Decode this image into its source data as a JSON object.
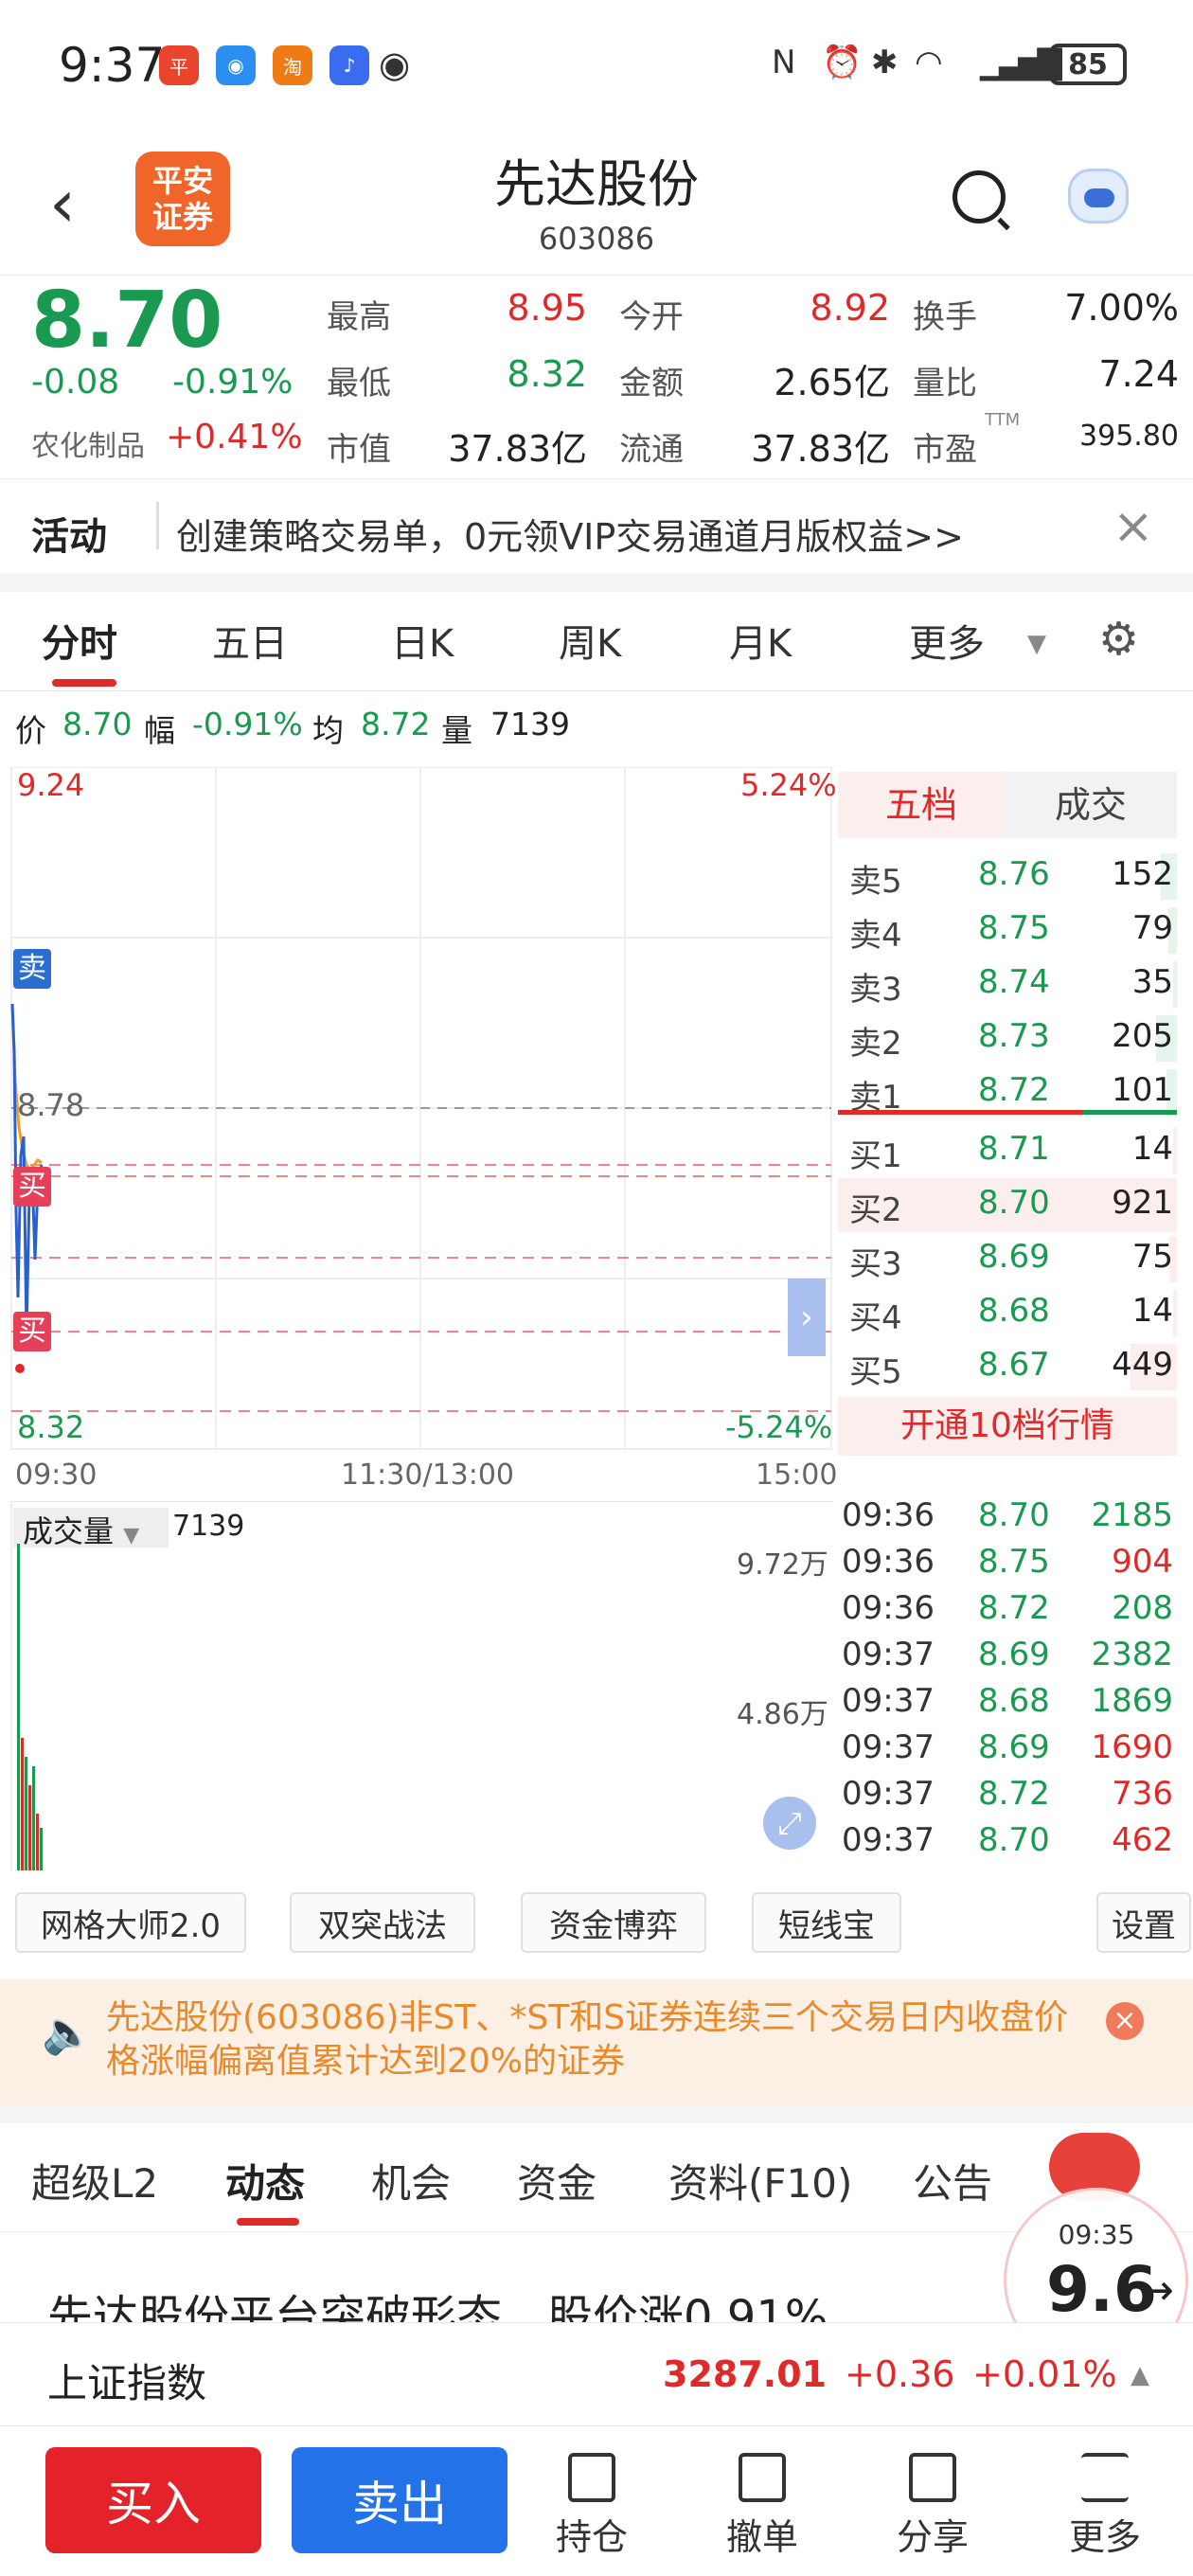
{
  "status": {
    "time": "9:37",
    "battery": "85"
  },
  "header": {
    "name": "先达股份",
    "code": "603086",
    "broker_logo": "平安\n证券"
  },
  "quote": {
    "price": "8.70",
    "change": "-0.08",
    "change_pct": "-0.91%",
    "sector": "农化制品",
    "sector_pct": "+0.41%",
    "fields": [
      {
        "label": "最高",
        "value": "8.95",
        "color": "red"
      },
      {
        "label": "今开",
        "value": "8.92",
        "color": "red"
      },
      {
        "label": "换手",
        "value": "7.00%",
        "color": "dark"
      },
      {
        "label": "最低",
        "value": "8.32",
        "color": "green"
      },
      {
        "label": "金额",
        "value": "2.65亿",
        "color": "dark"
      },
      {
        "label": "量比",
        "value": "7.24",
        "color": "dark"
      },
      {
        "label": "市值",
        "value": "37.83亿",
        "color": "dark"
      },
      {
        "label": "流通",
        "value": "37.83亿",
        "color": "dark"
      },
      {
        "label": "市盈",
        "sup": "TTM",
        "value": "395.80",
        "color": "dark"
      }
    ]
  },
  "activity": {
    "label": "活动",
    "text": "创建策略交易单，0元领VIP交易通道月版权益>>"
  },
  "tabs": [
    "分时",
    "五日",
    "日K",
    "周K",
    "月K",
    "更多"
  ],
  "info": {
    "price_label": "价",
    "price": "8.70",
    "amp_label": "幅",
    "amp": "-0.91%",
    "avg_label": "均",
    "avg": "8.72",
    "vol_label": "量",
    "vol": "7139"
  },
  "chart": {
    "top_left": "9.24",
    "top_right": "5.24%",
    "bottom_left": "8.32",
    "bottom_right": "-5.24%",
    "mid_label": "8.78",
    "times": [
      "09:30",
      "11:30/13:00",
      "15:00"
    ],
    "sell_tag": "卖",
    "buy_tag": "买"
  },
  "volume": {
    "label": "成交量",
    "value": "7139",
    "top": "9.72万",
    "mid": "4.86万"
  },
  "orderbook": {
    "tab_active": "五档",
    "tab_other": "成交",
    "asks": [
      {
        "l": "卖5",
        "p": "8.76",
        "v": "152",
        "f": 0.17
      },
      {
        "l": "卖4",
        "p": "8.75",
        "v": "79",
        "f": 0.09
      },
      {
        "l": "卖3",
        "p": "8.74",
        "v": "35",
        "f": 0.04
      },
      {
        "l": "卖2",
        "p": "8.73",
        "v": "205",
        "f": 0.22
      },
      {
        "l": "卖1",
        "p": "8.72",
        "v": "101",
        "f": 0.11
      }
    ],
    "bids": [
      {
        "l": "买1",
        "p": "8.71",
        "v": "14",
        "f": 0.02
      },
      {
        "l": "买2",
        "p": "8.70",
        "v": "921",
        "f": 1.0
      },
      {
        "l": "买3",
        "p": "8.69",
        "v": "75",
        "f": 0.08
      },
      {
        "l": "买4",
        "p": "8.68",
        "v": "14",
        "f": 0.02
      },
      {
        "l": "买5",
        "p": "8.67",
        "v": "449",
        "f": 0.49
      }
    ],
    "more": "开通10档行情"
  },
  "trades": [
    {
      "t": "09:36",
      "p": "8.70",
      "v": "2185",
      "c": "green"
    },
    {
      "t": "09:36",
      "p": "8.75",
      "v": "904",
      "c": "red"
    },
    {
      "t": "09:36",
      "p": "8.72",
      "v": "208",
      "c": "green"
    },
    {
      "t": "09:37",
      "p": "8.69",
      "v": "2382",
      "c": "green"
    },
    {
      "t": "09:37",
      "p": "8.68",
      "v": "1869",
      "c": "green"
    },
    {
      "t": "09:37",
      "p": "8.69",
      "v": "1690",
      "c": "red"
    },
    {
      "t": "09:37",
      "p": "8.72",
      "v": "736",
      "c": "red"
    },
    {
      "t": "09:37",
      "p": "8.70",
      "v": "462",
      "c": "red"
    }
  ],
  "tools": [
    "网格大师2.0",
    "双突战法",
    "资金博弈",
    "短线宝",
    "设置"
  ],
  "notice": {
    "text": "先达股份(603086)非ST、*ST和S证券连续三个交易日内收盘价格涨幅偏离值累计达到20%的证券"
  },
  "subtabs": [
    "超级L2",
    "动态",
    "机会",
    "资金",
    "资料(F10)",
    "公告"
  ],
  "news": {
    "headline": "先达股份平台突破形态，股价涨0.91%"
  },
  "badge": {
    "time": "09:35",
    "score": "9.6"
  },
  "index": {
    "name": "上证指数",
    "value": "3287.01",
    "change": "+0.36",
    "pct": "+0.01%"
  },
  "bottom": {
    "buy": "买入",
    "sell": "卖出",
    "items": [
      "持仓",
      "撤单",
      "分享",
      "更多"
    ]
  }
}
